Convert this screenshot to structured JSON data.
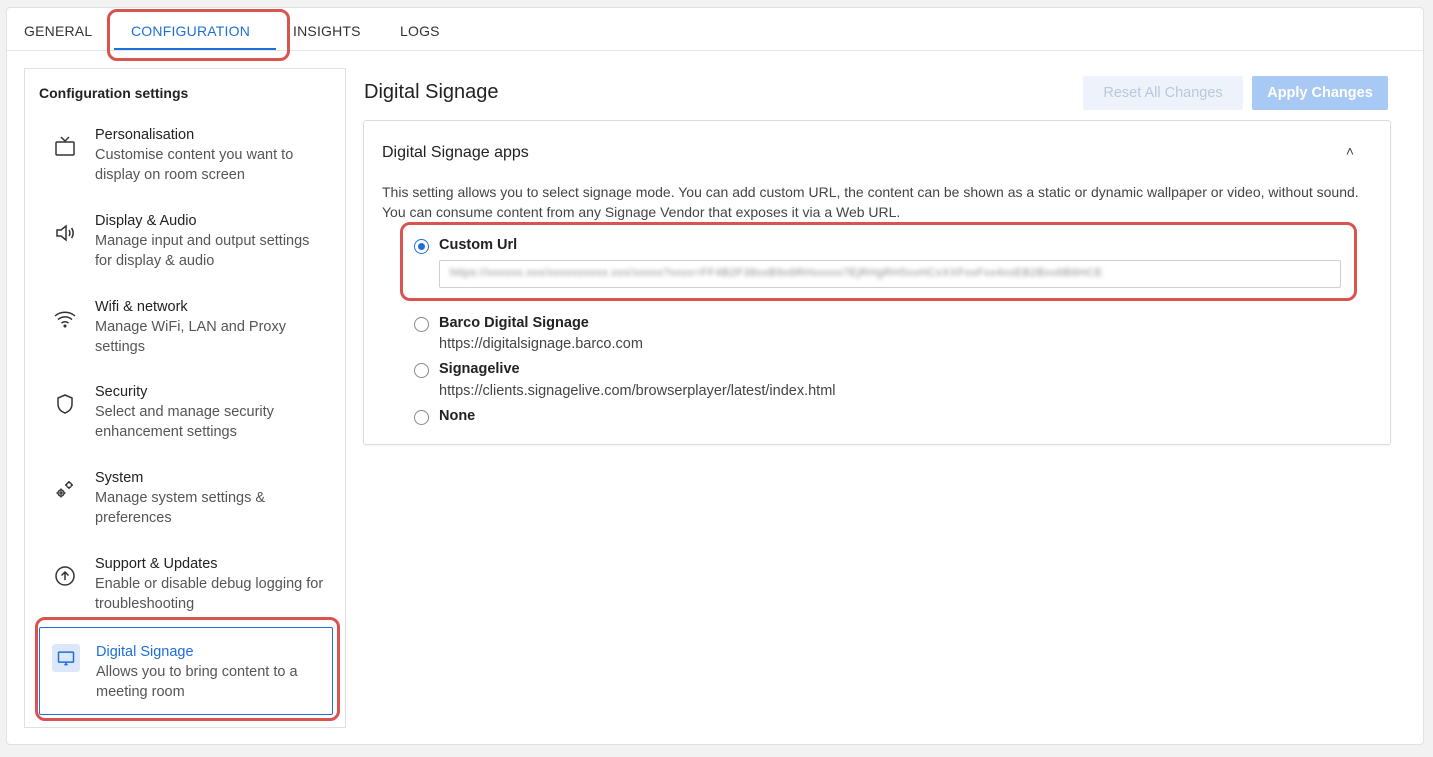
{
  "tabs": [
    {
      "label": "GENERAL"
    },
    {
      "label": "CONFIGURATION"
    },
    {
      "label": "INSIGHTS"
    },
    {
      "label": "LOGS"
    }
  ],
  "sidebar": {
    "title": "Configuration settings",
    "items": [
      {
        "label": "Personalisation",
        "desc": "Customise content you want to display on room screen",
        "icon": "tv-icon"
      },
      {
        "label": "Display & Audio",
        "desc": "Manage input and output settings for display & audio",
        "icon": "speaker-icon"
      },
      {
        "label": "Wifi & network",
        "desc": "Manage WiFi, LAN and Proxy settings",
        "icon": "wifi-icon"
      },
      {
        "label": "Security",
        "desc": "Select and manage security enhancement settings",
        "icon": "shield-icon"
      },
      {
        "label": "System",
        "desc": "Manage system settings & preferences",
        "icon": "gears-icon"
      },
      {
        "label": "Support & Updates",
        "desc": "Enable or disable debug logging for troubleshooting",
        "icon": "upload-circle-icon"
      },
      {
        "label": "Digital Signage",
        "desc": "Allows you to bring content to a meeting room",
        "icon": "monitor-icon"
      }
    ]
  },
  "main": {
    "title": "Digital Signage",
    "reset_label": "Reset All Changes",
    "apply_label": "Apply Changes",
    "section": {
      "title": "Digital Signage apps",
      "chevron": "˄",
      "description": "This setting allows you to select signage mode. You can add custom URL, the content can be shown as a static or dynamic wallpaper or video, without sound. You can consume content from any Signage Vendor that exposes it via a Web URL.",
      "options": [
        {
          "label": "Custom Url",
          "url": "",
          "checked": true
        },
        {
          "label": "Barco Digital Signage",
          "url": "https://digitalsignage.barco.com",
          "checked": false
        },
        {
          "label": "Signagelive",
          "url": "https://clients.signagelive.com/browserplayer/latest/index.html",
          "checked": false
        },
        {
          "label": "None",
          "url": "",
          "checked": false
        }
      ],
      "custom_url_value": "https://xxxxxx.xxx/xxxxxxxxxx.xxx/xxxxx?xxxx=FF4B2F38xxB9x6RHxxxxx7EjRHgRH5xxHCxXXFxxFxx4xxEB2Bxx6B6HCE"
    }
  },
  "colors": {
    "accent": "#1e6fd9",
    "highlight": "#d9534f",
    "apply_bg": "#a7c9f3"
  }
}
